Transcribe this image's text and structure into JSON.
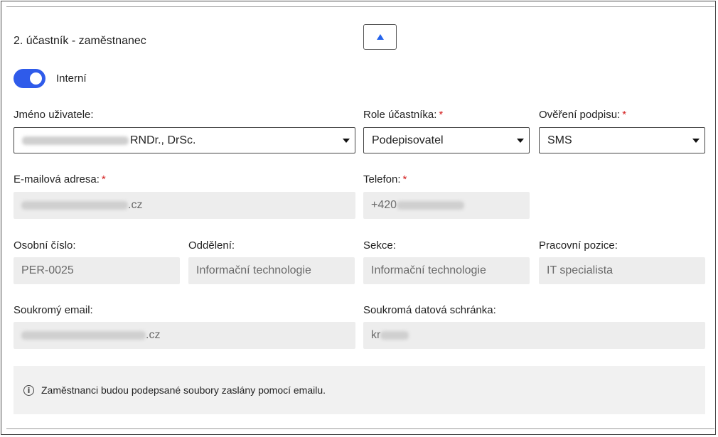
{
  "section": {
    "title": "2. účastník - zaměstnanec",
    "collapse_icon": "caret-up-icon"
  },
  "toggle": {
    "label": "Interní",
    "state": true,
    "color": "#2f5bea"
  },
  "fields": {
    "user_name": {
      "label": "Jméno uživatele:",
      "value_suffix": "RNDr., DrSc."
    },
    "role": {
      "label": "Role účastníka:",
      "required_mark": "*",
      "value": "Podepisovatel"
    },
    "signature_verification": {
      "label": "Ověření podpisu:",
      "required_mark": "*",
      "value": "SMS"
    },
    "email": {
      "label": "E-mailová adresa:",
      "required_mark": "*",
      "value_suffix": ".cz"
    },
    "phone": {
      "label": "Telefon:",
      "required_mark": "*",
      "value_prefix": "+420"
    },
    "personal_number": {
      "label": "Osobní číslo:",
      "value": "PER-0025"
    },
    "department": {
      "label": "Oddělení:",
      "value": "Informační technologie"
    },
    "section_field": {
      "label": "Sekce:",
      "value": "Informační technologie"
    },
    "position": {
      "label": "Pracovní pozice:",
      "value": "IT specialista"
    },
    "private_email": {
      "label": "Soukromý email:",
      "value_suffix": ".cz"
    },
    "data_box": {
      "label": "Soukromá datová schránka:",
      "value_prefix": "kr"
    }
  },
  "info": {
    "icon": "info-icon",
    "glyph": "i",
    "text": "Zaměstnanci budou podepsané soubory zaslány pomocí emailu."
  },
  "colors": {
    "required": "#d42020",
    "accent": "#2563eb"
  }
}
